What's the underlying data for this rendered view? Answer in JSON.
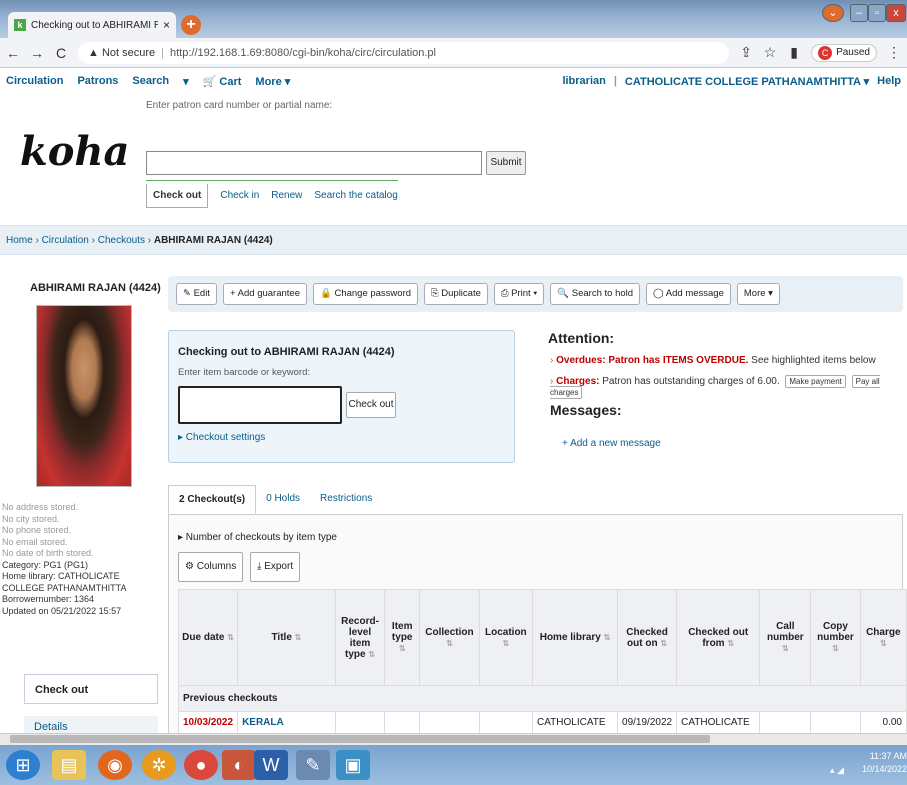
{
  "browser": {
    "tab_title": "Checking out to ABHIRAMI RAJA",
    "close": "×",
    "new_tab": "+",
    "back": "←",
    "forward": "→",
    "reload": "C",
    "not_secure": "▲ Not secure",
    "url": "http://192.168.1.69:8080/cgi-bin/koha/circ/circulation.pl",
    "paused": "Paused",
    "profile_letter": "C"
  },
  "topnav": {
    "items": [
      "Circulation",
      "Patrons",
      "Search",
      "▾",
      "🛒 Cart",
      "More ▾"
    ],
    "user": "librarian",
    "library": "CATHOLICATE COLLEGE PATHANAMTHITTA ▾",
    "help": "Help"
  },
  "header": {
    "logo": "koha",
    "search_label": "Enter patron card number or partial name:",
    "submit": "Submit",
    "subtabs": [
      "Check out",
      "Check in",
      "Renew",
      "Search the catalog"
    ]
  },
  "breadcrumb": {
    "home": "Home",
    "circulation": "Circulation",
    "checkouts": "Checkouts",
    "patron": "ABHIRAMI RAJAN (4424)"
  },
  "patron": {
    "name": "ABHIRAMI RAJAN (4424)",
    "info": [
      "No address stored.",
      "No city stored.",
      "No phone stored.",
      "No email stored.",
      "No date of birth stored."
    ],
    "category": "Category: PG1 (PG1)",
    "home_library": "Home library: CATHOLICATE COLLEGE PATHANAMTHITTA",
    "borrowernumber": "Borrowernumber: 1364",
    "updated": "Updated on 05/21/2022 15:57"
  },
  "leftnav": {
    "checkout": "Check out",
    "details": "Details"
  },
  "toolbar": [
    "✎ Edit",
    "+ Add guarantee",
    "🔒 Change password",
    "⎘ Duplicate",
    "⎙ Print ▾",
    "🔍 Search to hold",
    "◯ Add message",
    "More ▾"
  ],
  "checkout": {
    "title": "Checking out to ABHIRAMI RAJAN (4424)",
    "label": "Enter item barcode or keyword:",
    "button": "Check out",
    "settings": "▸ Checkout settings"
  },
  "attention": {
    "title": "Attention:",
    "overdue_label": "Overdues: Patron has ITEMS OVERDUE.",
    "overdue_rest": "See highlighted items below",
    "charges_label": "Charges:",
    "charges_rest": "Patron has outstanding charges of 6.00.",
    "make_payment": "Make payment",
    "pay_all": "Pay all charges",
    "messages": "Messages:",
    "add_message": "+ Add a new message"
  },
  "tabs": [
    "2 Checkout(s)",
    "0 Holds",
    "Restrictions"
  ],
  "panel": {
    "num_by_type": "▸ Number of checkouts by item type",
    "columns": "⚙ Columns",
    "export": "⤓ Export"
  },
  "table": {
    "headers": [
      "Due date",
      "Title",
      "Record-level item type",
      "Item type",
      "Collection",
      "Location",
      "Home library",
      "Checked out on",
      "Checked out from",
      "Call number",
      "Copy number",
      "Charge"
    ],
    "group": "Previous checkouts",
    "row": [
      "10/03/2022",
      "KERALA",
      "",
      "",
      "",
      "",
      "CATHOLICATE",
      "09/19/2022",
      "CATHOLICATE",
      "",
      "",
      "0.00"
    ]
  },
  "taskbar": {
    "time": "11:37 AM",
    "date": "10/14/2022"
  }
}
